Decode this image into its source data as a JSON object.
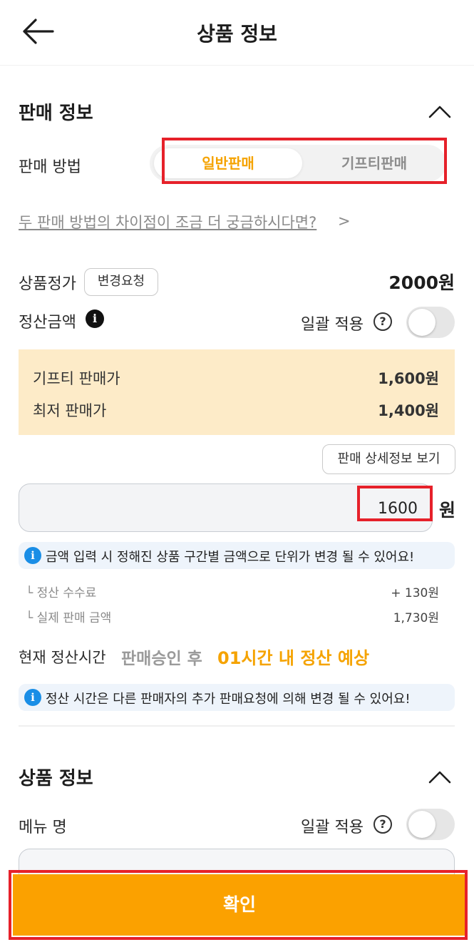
{
  "header": {
    "title": "상품 정보"
  },
  "sales_section": {
    "title": "판매 정보",
    "method_label": "판매 방법",
    "method_options": [
      "일반판매",
      "기프티판매"
    ],
    "selected_method": "일반판매",
    "diff_link": "두 판매 방법의 차이점이 조금 더 궁금하시다면?",
    "diff_arrow": ">",
    "list_price_label": "상품정가",
    "change_request_button": "변경요청",
    "list_price_value": "2000원",
    "settlement_label": "정산금액",
    "bulk_apply_label": "일괄 적용",
    "bulk_apply_on": false,
    "price_box": {
      "rows": [
        {
          "label": "기프티 판매가",
          "value": "1,600원"
        },
        {
          "label": "최저 판매가",
          "value": "1,400원"
        }
      ]
    },
    "detail_button": "판매 상세정보 보기",
    "amount_input_value": "1600",
    "amount_unit": "원",
    "notice_amount": "금액 입력 시 정해진 상품 구간별 금액으로 단위가 변경 될 수 있어요!",
    "fee_rows": [
      {
        "label": "└ 정산 수수료",
        "value": "+ 130원"
      },
      {
        "label": "└ 실제 판매 금액",
        "value": "1,730원"
      }
    ],
    "settle_time_label": "현재 정산시간",
    "settle_time_prefix": "판매승인 후",
    "settle_time_highlight": "01시간 내 정산 예상",
    "notice_time": "정산 시간은 다른 판매자의 추가 판매요청에 의해 변경 될 수 있어요!"
  },
  "product_section": {
    "title": "상품 정보",
    "menu_name_label": "메뉴 명",
    "bulk_apply_label": "일괄 적용",
    "bulk_apply_on": false
  },
  "confirm_button": "확인",
  "colors": {
    "accent": "#fba100",
    "accent_text": "#f5a300",
    "highlight_border": "#e6212a",
    "price_box_bg": "#fdebc8",
    "notice_bg": "#eef4fb",
    "info_blue": "#1a8ee6"
  },
  "icons": [
    "back-arrow-icon",
    "chevron-up-icon",
    "info-icon",
    "question-icon",
    "info-circle-icon"
  ]
}
